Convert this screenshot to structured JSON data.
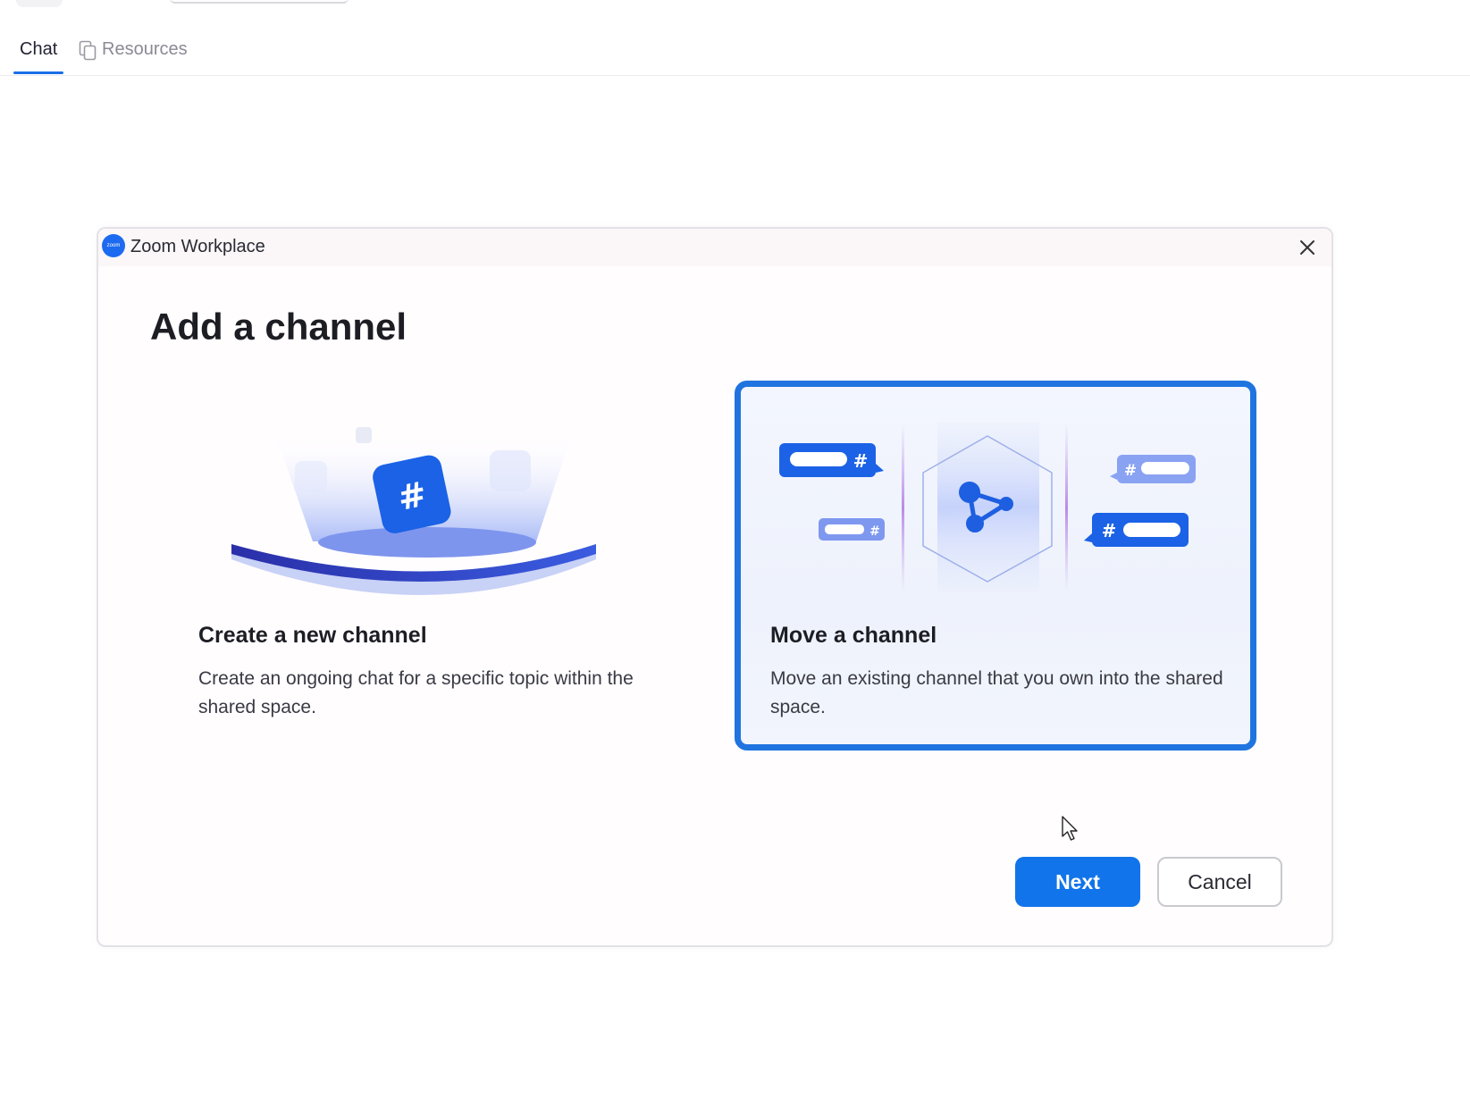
{
  "tabs": [
    {
      "label": "Chat",
      "active": true
    },
    {
      "label": "Resources",
      "active": false
    }
  ],
  "dialog": {
    "app_title": "Zoom Workplace",
    "app_logo_text": "zoom",
    "heading": "Add a channel",
    "options": [
      {
        "title": "Create a new channel",
        "description": "Create an ongoing chat for a specific topic within the shared space.",
        "selected": false,
        "icon": "hash-icon"
      },
      {
        "title": "Move a channel",
        "description": "Move an existing channel that you own into the shared space.",
        "selected": true,
        "icon": "share-nodes-icon"
      }
    ],
    "next_label": "Next",
    "cancel_label": "Cancel"
  },
  "colors": {
    "accent": "#1174ea",
    "selected_border": "#1f74df",
    "tab_underline": "#1a6ee8"
  }
}
